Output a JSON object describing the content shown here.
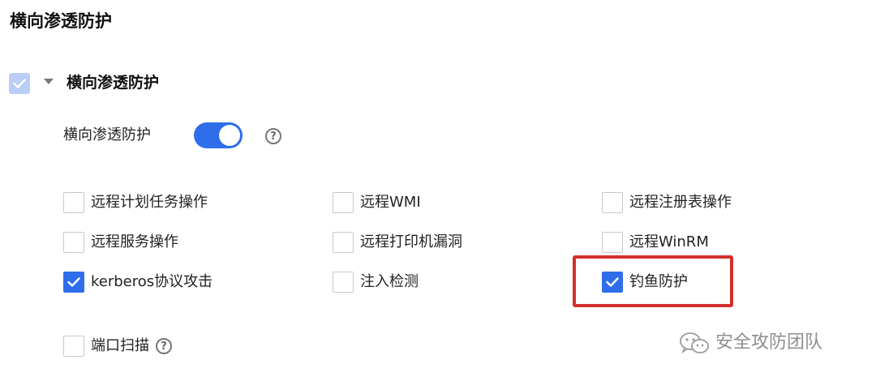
{
  "page": {
    "title": "横向渗透防护"
  },
  "section": {
    "label": "横向渗透防护",
    "checked": true,
    "expanded": true
  },
  "toggle": {
    "label": "横向渗透防护",
    "on": true,
    "help_icon": "question-circle-icon"
  },
  "options": [
    {
      "label": "远程计划任务操作",
      "checked": false
    },
    {
      "label": "远程WMI",
      "checked": false
    },
    {
      "label": "远程注册表操作",
      "checked": false
    },
    {
      "label": "远程服务操作",
      "checked": false
    },
    {
      "label": "远程打印机漏洞",
      "checked": false
    },
    {
      "label": "远程WinRM",
      "checked": false
    },
    {
      "label": "kerberos协议攻击",
      "checked": true
    },
    {
      "label": "注入检测",
      "checked": false
    },
    {
      "label": "钓鱼防护",
      "checked": true
    }
  ],
  "port_scan": {
    "label": "端口扫描",
    "checked": false,
    "help_icon": "question-circle-icon"
  },
  "watermark": {
    "text": "安全攻防团队",
    "icon": "wechat-icon"
  },
  "colors": {
    "accent": "#2f6eea",
    "highlight": "#d2302c",
    "disabled_check": "#b9cdf7"
  }
}
